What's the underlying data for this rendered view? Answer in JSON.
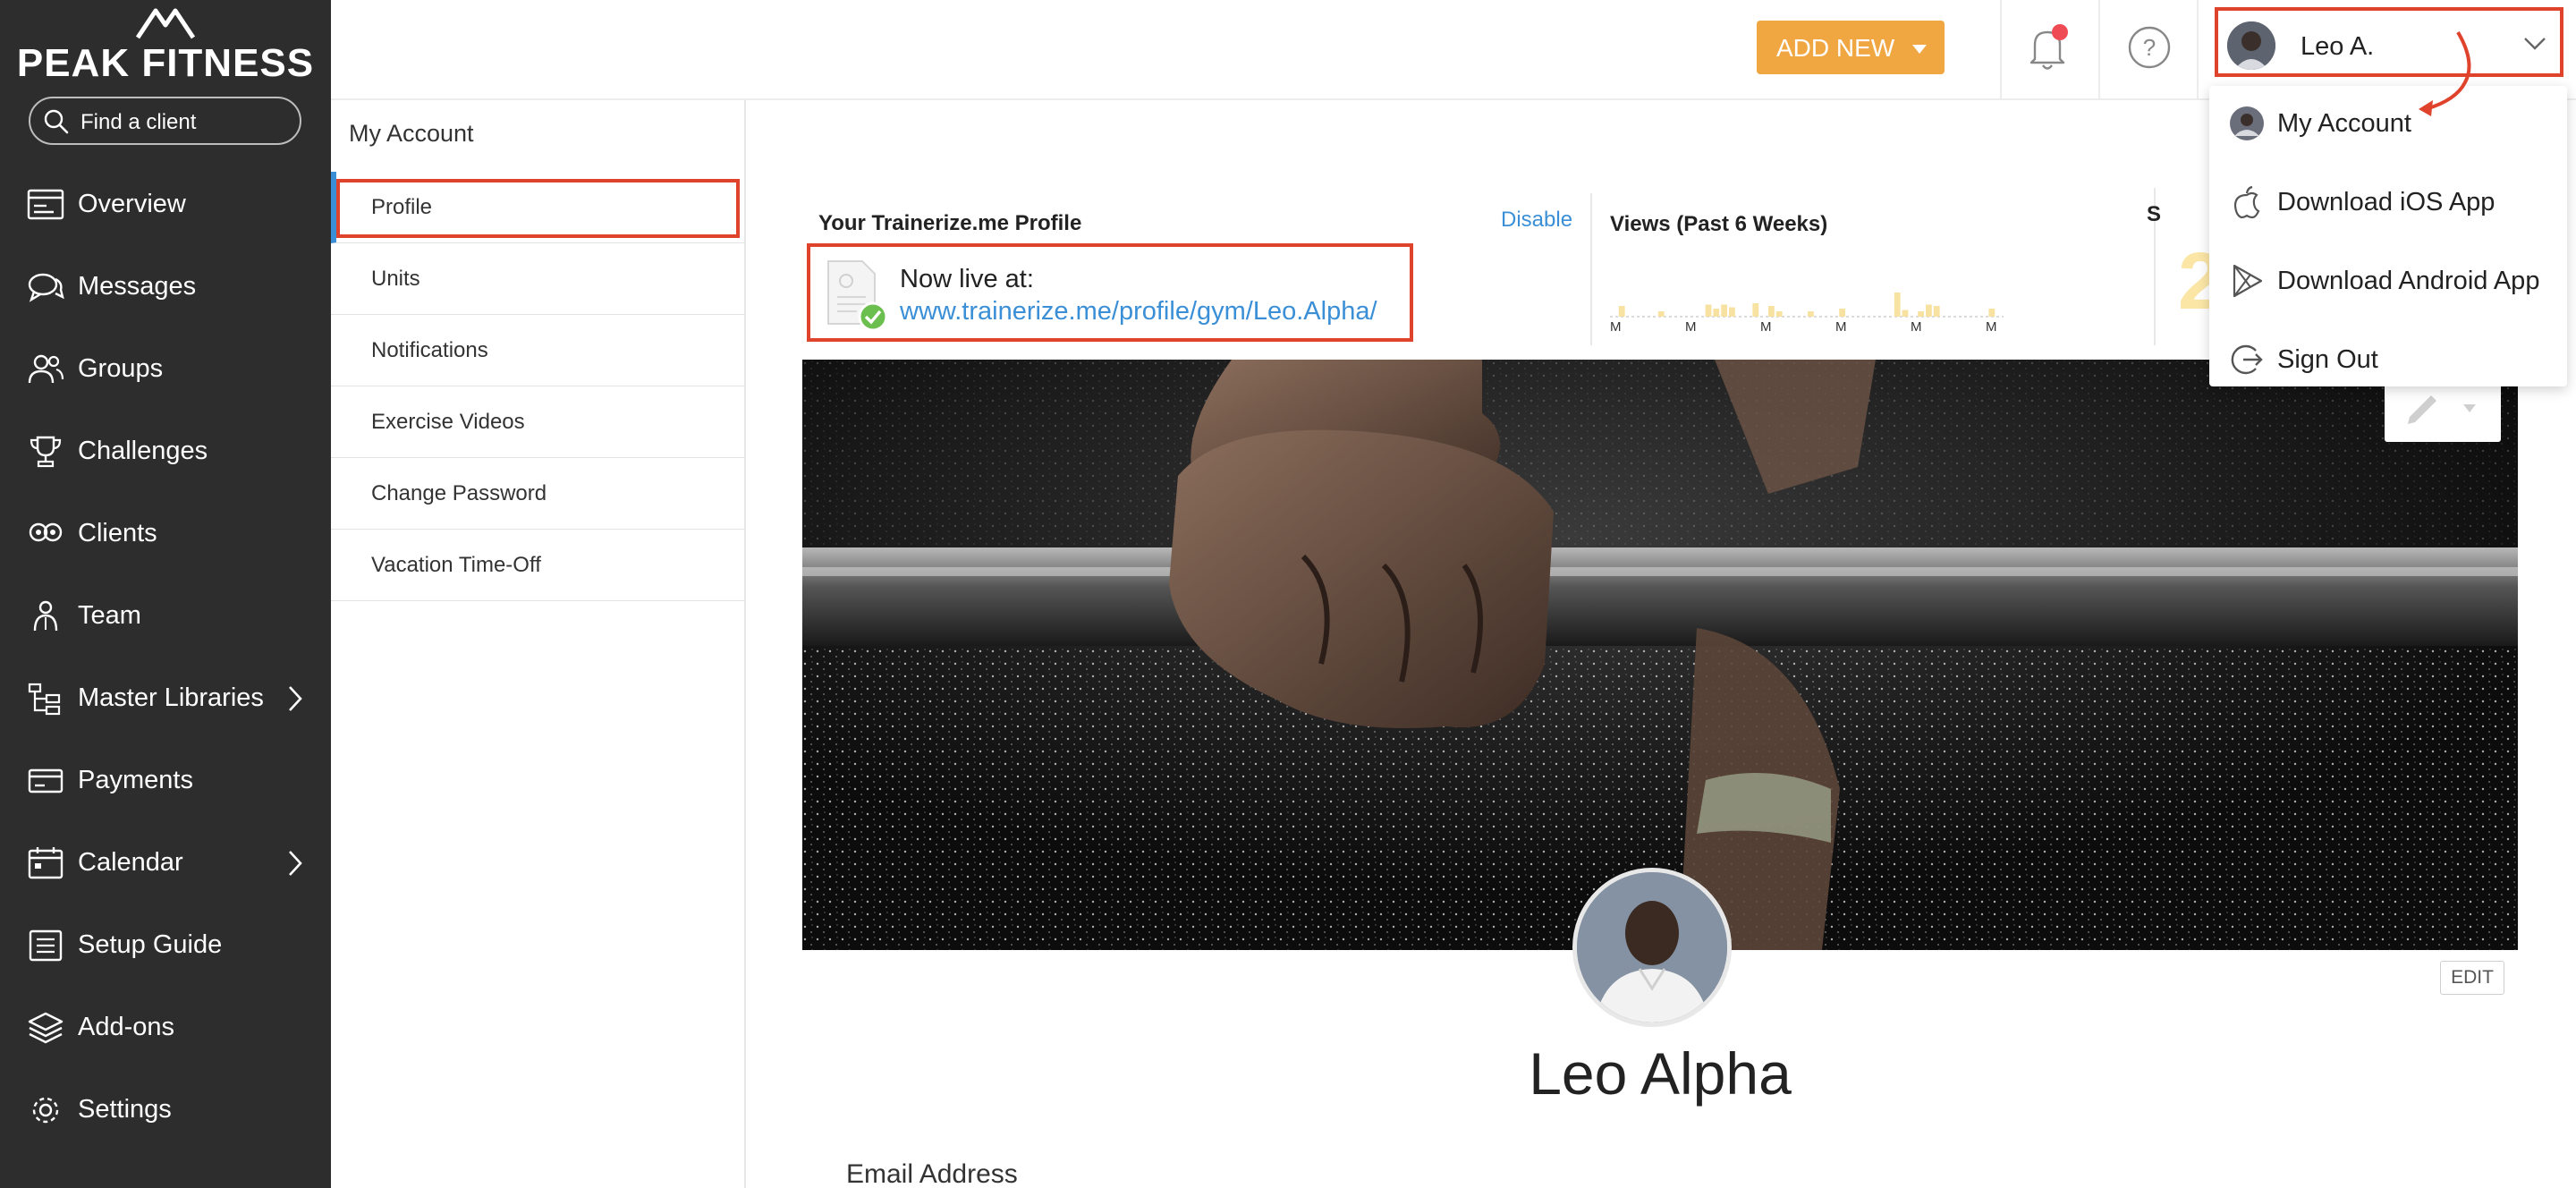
{
  "brand": {
    "name": "PEAK FITNESS"
  },
  "search": {
    "placeholder": "Find a client"
  },
  "sidebar": {
    "items": [
      {
        "label": "Overview",
        "icon": "overview-icon"
      },
      {
        "label": "Messages",
        "icon": "messages-icon"
      },
      {
        "label": "Groups",
        "icon": "groups-icon"
      },
      {
        "label": "Challenges",
        "icon": "trophy-icon"
      },
      {
        "label": "Clients",
        "icon": "clients-icon"
      },
      {
        "label": "Team",
        "icon": "team-icon"
      },
      {
        "label": "Master Libraries",
        "icon": "libraries-icon",
        "has_submenu": true
      },
      {
        "label": "Payments",
        "icon": "payments-icon"
      },
      {
        "label": "Calendar",
        "icon": "calendar-icon",
        "has_submenu": true
      },
      {
        "label": "Setup Guide",
        "icon": "setup-guide-icon"
      },
      {
        "label": "Add-ons",
        "icon": "addons-icon"
      },
      {
        "label": "Settings",
        "icon": "gear-icon"
      }
    ]
  },
  "subnav": {
    "title": "My Account",
    "items": [
      "Profile",
      "Units",
      "Notifications",
      "Exercise Videos",
      "Change Password",
      "Vacation Time-Off"
    ],
    "selected": "Profile"
  },
  "topbar": {
    "add_new_label": "ADD NEW",
    "user_name": "Leo A.",
    "notification_dot_color": "#ef4b55"
  },
  "user_dropdown": {
    "items": [
      {
        "label": "My Account",
        "icon": "avatar-icon"
      },
      {
        "label": "Download iOS App",
        "icon": "apple-icon"
      },
      {
        "label": "Download Android App",
        "icon": "play-store-icon"
      },
      {
        "label": "Sign Out",
        "icon": "sign-out-icon"
      }
    ]
  },
  "trainerize_profile": {
    "title": "Your Trainerize.me Profile",
    "disable_label": "Disable",
    "live_label": "Now live at:",
    "url": "www.trainerize.me/profile/gym/Leo.Alpha/"
  },
  "views": {
    "title": "Views (Past 6 Weeks)",
    "week_labels": [
      "M",
      "M",
      "M",
      "M",
      "M",
      "M"
    ],
    "bar_levels": [
      0,
      0.4,
      0,
      0,
      0,
      0,
      0.2,
      0,
      0,
      0,
      0,
      0,
      0.45,
      0.3,
      0.45,
      0.35,
      0,
      0,
      0.5,
      0,
      0.4,
      0.2,
      0,
      0,
      0,
      0.2,
      0,
      0,
      0,
      0.3,
      0,
      0,
      0,
      0,
      0,
      0,
      0.9,
      0.25,
      0,
      0.2,
      0.45,
      0.4,
      0,
      0,
      0,
      0,
      0,
      0,
      0.3,
      0
    ],
    "bar_color": "#f8e2a2"
  },
  "stats": {
    "label_letter": "S",
    "value": "2"
  },
  "profile": {
    "name": "Leo Alpha",
    "edit_label": "EDIT",
    "email_label": "Email Address"
  },
  "colors": {
    "sidebar_bg": "#2d2d2d",
    "accent_orange": "#f0a742",
    "link_blue": "#3a8fd6",
    "annotation_red": "#e0432b"
  }
}
